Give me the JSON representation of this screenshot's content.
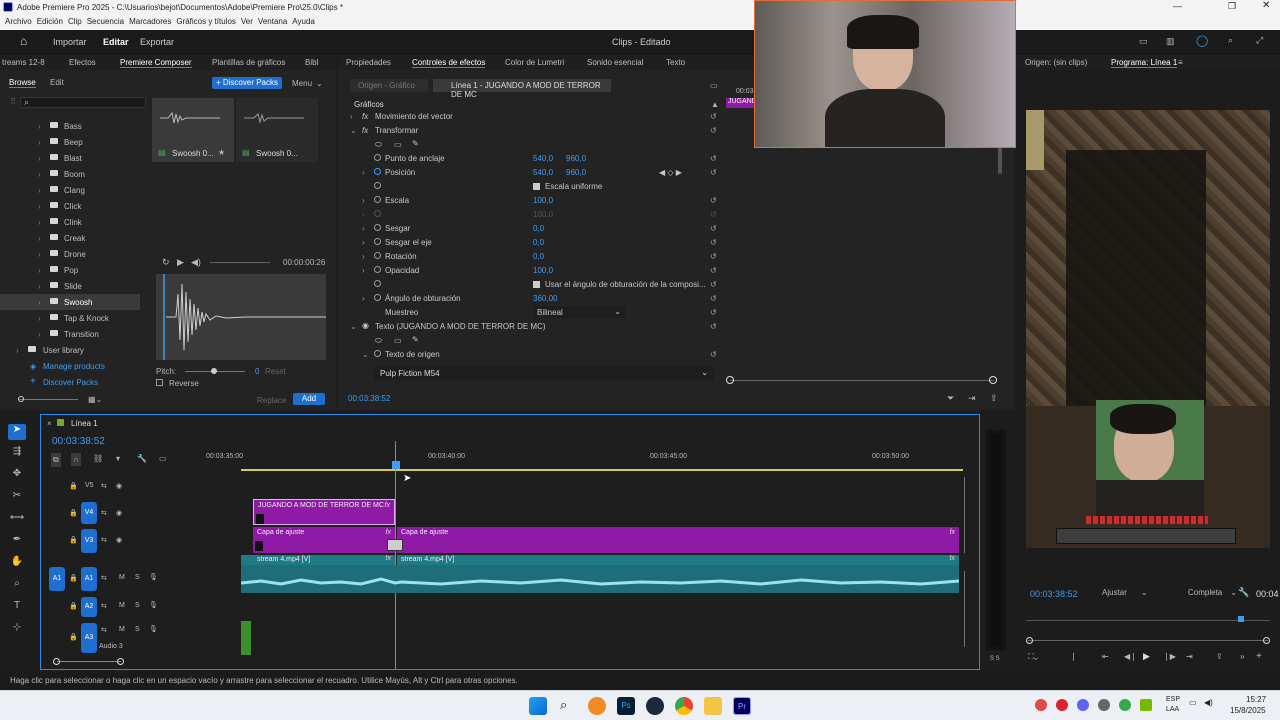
{
  "window": {
    "title": "Adobe Premiere Pro 2025 - C:\\Usuarios\\bejot\\Documentos\\Adobe\\Premiere Pro\\25.0\\Clips *"
  },
  "menu": [
    "Archivo",
    "Edición",
    "Clip",
    "Secuencia",
    "Marcadores",
    "Gráficos y títulos",
    "Ver",
    "Ventana",
    "Ayuda"
  ],
  "app": {
    "workspaces": [
      "Importar",
      "Editar",
      "Exportar"
    ],
    "project": "Clips - Editado"
  },
  "left_panel": {
    "tabs": [
      "treams 12-8",
      "Efectos",
      "Premiere Composer",
      "Plantillas de gráficos",
      "Bibl"
    ],
    "subtabs": [
      "Browse",
      "Edit"
    ],
    "discover_packs": "+ Discover Packs",
    "menu_label": "Menu",
    "folders": [
      "Bass",
      "Beep",
      "Blast",
      "Boom",
      "Clang",
      "Click",
      "Clink",
      "Creak",
      "Drone",
      "Pop",
      "Slide",
      "Swoosh",
      "Tap & Knock",
      "Transition"
    ],
    "selected_folder": "Swoosh",
    "user_library": "User library",
    "manage_products": "Manage products",
    "discover_packs_link": "Discover Packs",
    "tiles": [
      "Swoosh 0...",
      "Swoosh 0..."
    ],
    "player_time": "00:00:00:26",
    "pitch_label": "Pitch:",
    "pitch_value": "0",
    "reset_label": "Reset",
    "reverse_label": "Reverse",
    "replace_label": "Replace",
    "add_label": "Add"
  },
  "effects_panel": {
    "tabs": [
      "Propiedades",
      "Controles de efectos",
      "Color de Lumetri",
      "Sonido esencial",
      "Texto"
    ],
    "source_tab": "Origen - Gráfico",
    "clip_tab": "Línea 1 - JUGANDO A MOD DE TERROR DE MC",
    "mini_time": "00:03",
    "mini_clip": "JUGAND",
    "section": "Gráficos",
    "motion_vector": "Movimiento del vector",
    "transform": "Transformar",
    "props": [
      {
        "label": "Punto de anclaje",
        "v1": "540,0",
        "v2": "960,0"
      },
      {
        "label": "Posición",
        "v1": "540,0",
        "v2": "960,0"
      },
      {
        "label": "Escala uniforme"
      },
      {
        "label": "Escala",
        "v1": "100,0"
      },
      {
        "label": "",
        "v1": "100,0"
      },
      {
        "label": "Sesgar",
        "v1": "0,0"
      },
      {
        "label": "Sesgar el eje",
        "v1": "0,0"
      },
      {
        "label": "Rotación",
        "v1": "0,0"
      },
      {
        "label": "Opacidad",
        "v1": "100,0"
      },
      {
        "label": "Usar el ángulo de obturación de la composi..."
      },
      {
        "label": "Ángulo de obturación",
        "v1": "360,00"
      },
      {
        "label": "Muestreo",
        "v1": "Bilineal"
      },
      {
        "label": "Texto (JUGANDO A MOD DE TERROR DE MC)"
      },
      {
        "label": ""
      },
      {
        "label": "Texto de origen"
      }
    ],
    "font": "Pulp Fiction M54",
    "timecode": "00:03:38:52"
  },
  "program_panel": {
    "tabs": [
      "Origen: (sin clips)",
      "Programa: Línea 1"
    ],
    "timecode": "00:03:38:52",
    "fit": "Ajustar",
    "quality": "Completa",
    "right_time": "00:04"
  },
  "timeline": {
    "sequence": "Línea 1",
    "timecode": "00:03:38:52",
    "ruler": [
      "00:03:35:00",
      "00:03:40:00",
      "00:03:45:00",
      "00:03:50:00"
    ],
    "tracks": [
      {
        "id": "V5",
        "name": ""
      },
      {
        "id": "V4",
        "name": ""
      },
      {
        "id": "V3",
        "name": ""
      },
      {
        "id": "A1",
        "name": ""
      },
      {
        "id": "A2",
        "name": ""
      },
      {
        "id": "A3",
        "name": "Audio 3"
      }
    ],
    "clips": {
      "title": "JUGANDO A MOD DE TERROR DE MC",
      "adj1": "Capa de ajuste",
      "adj2": "Capa de ajuste",
      "stream1": "stream 4.mp4 [V]",
      "stream2": "stream 4.mp4 [V]",
      "fx": "fx"
    }
  },
  "status_bar": "Haga clic para seleccionar o haga clic en un espacio vacío y arrastre para seleccionar el recuadro. Utilice Mayús, Alt y Ctrl para otras opciones.",
  "taskbar": {
    "lang1": "ESP",
    "lang2": "LAA",
    "time": "15:27",
    "date": "15/8/2025"
  },
  "colors": {
    "accent": "#2d8ceb",
    "clip_purple": "#8e1aa6",
    "clip_teal": "#1d7b86",
    "audio_green": "#3e8e2a"
  }
}
